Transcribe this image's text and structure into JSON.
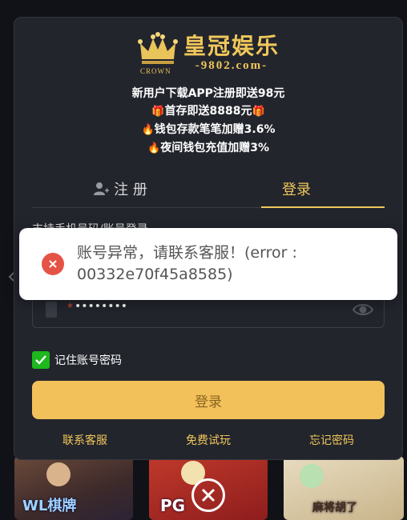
{
  "brand": {
    "name": "皇冠娱乐",
    "domain": "-9802.com-",
    "crown_label": "CROWN"
  },
  "promo": {
    "line1": "新用户下载APP注册即送98元",
    "line2": "首存即送8888元",
    "line3": "钱包存款笔笔加赠3.6%",
    "line4": "夜间钱包充值加赠3%"
  },
  "tabs": {
    "register": "注 册",
    "login": "登录"
  },
  "form": {
    "hint": "支持手机号码/账号登录",
    "password_value": "••••••••",
    "remember_label": "记住账号密码",
    "remember_checked": true,
    "login_button": "登录"
  },
  "links": {
    "contact": "联系客服",
    "trial": "免费试玩",
    "forgot": "忘记密码"
  },
  "toast": {
    "message": "账号异常，请联系客服！(error : 00332e70f45a8585)",
    "type": "error"
  },
  "background_tiles": {
    "tile1": "WL棋牌",
    "tile2": "PG",
    "tile3": "麻将胡了"
  },
  "colors": {
    "accent": "#f0c75a",
    "button": "#f2c15a",
    "modal_bg": "#23252d",
    "error": "#e45346",
    "checkbox": "#1db81d"
  }
}
